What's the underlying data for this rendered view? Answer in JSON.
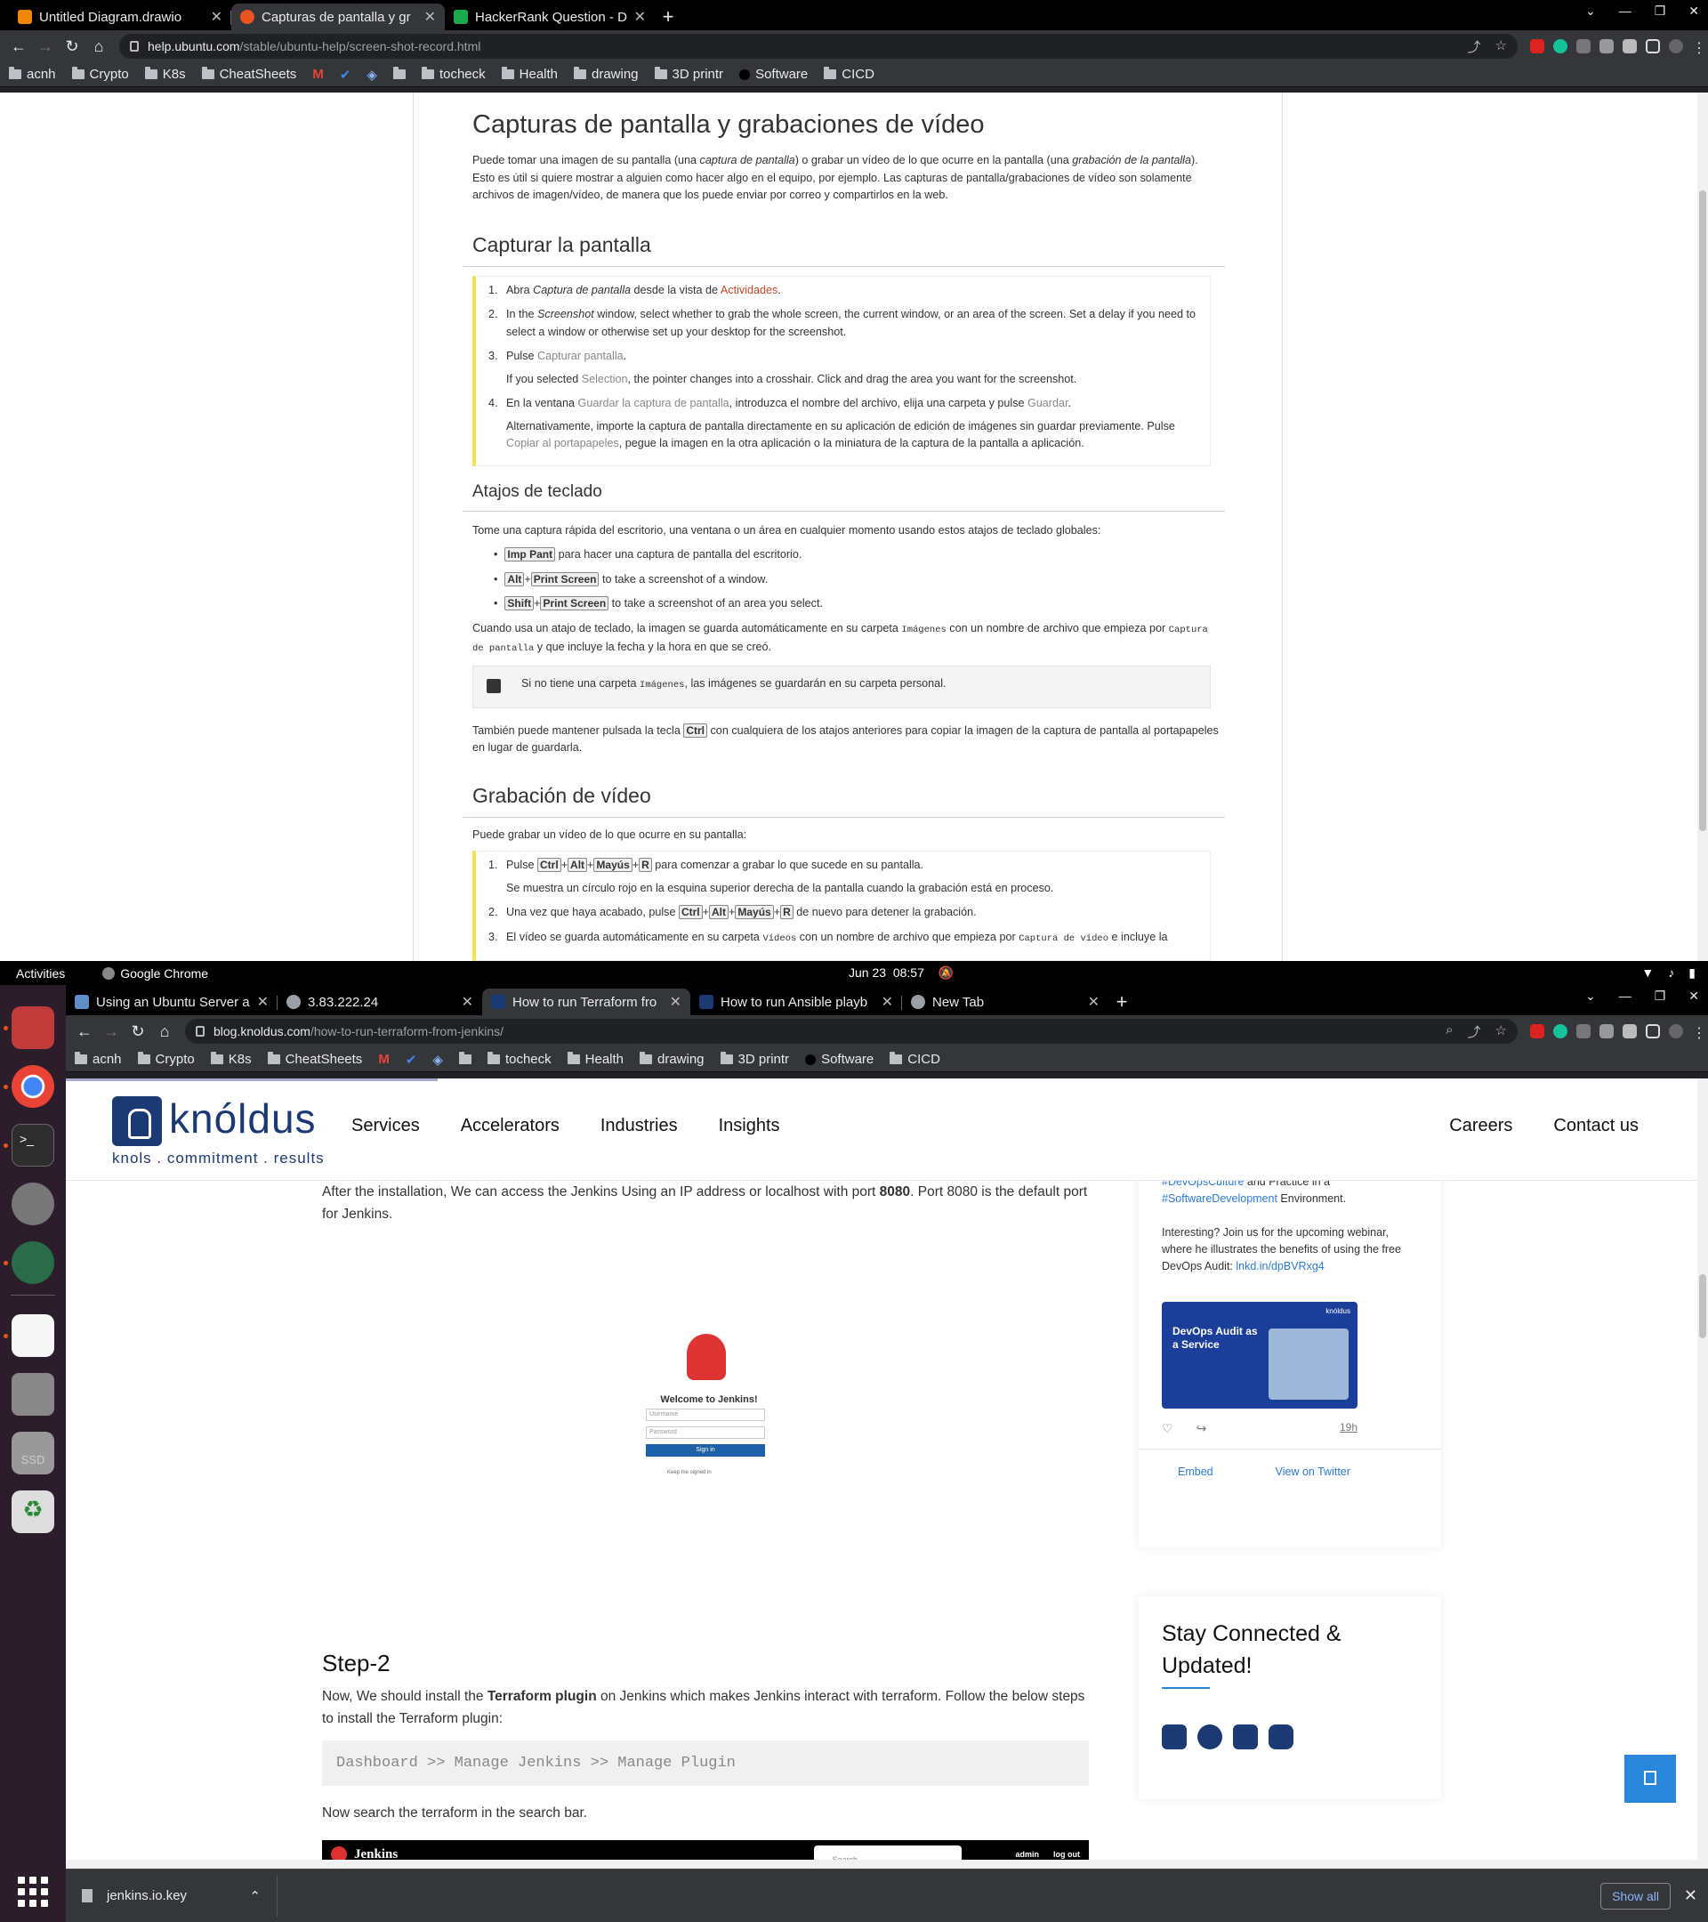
{
  "top_browser": {
    "tabs": [
      {
        "title": "Untitled Diagram.drawio",
        "fav_color": "#f08705",
        "active": false
      },
      {
        "title": "Capturas de pantalla y gr",
        "fav_color": "#e95420",
        "active": true
      },
      {
        "title": "HackerRank Question - De",
        "fav_color": "#1ba94c",
        "active": false
      }
    ],
    "url_host": "help.ubuntu.com",
    "url_path": "/stable/ubuntu-help/screen-shot-record.html"
  },
  "bookmarks": [
    "acnh",
    "Crypto",
    "K8s",
    "CheatSheets",
    "tocheck",
    "Health",
    "drawing",
    "3D printr",
    "Software",
    "CICD"
  ],
  "help": {
    "h1": "Capturas de pantalla y grabaciones de vídeo",
    "intro_1": "Puede tomar una imagen de su pantalla (una ",
    "intro_em1": "captura de pantalla",
    "intro_2": ") o grabar un vídeo de lo que ocurre en la pantalla (una ",
    "intro_em2": "grabación de la pantalla",
    "intro_3": "). Esto es útil si quiere mostrar a alguien como hacer algo en el equipo, por ejemplo. Las capturas de pantalla/grabaciones de vídeo son solamente archivos de imagen/vídeo, de manera que los puede enviar por correo y compartirlos en la web.",
    "h2_capture": "Capturar la pantalla",
    "s1_a": "Abra ",
    "s1_em": "Captura de pantalla",
    "s1_b": " desde la vista de ",
    "s1_link": "Actividades",
    "s1_c": ".",
    "s2_a": "In the ",
    "s2_em": "Screenshot",
    "s2_b": " window, select whether to grab the whole screen, the current window, or an area of the screen. Set a delay if you need to select a window or otherwise set up your desktop for the screenshot.",
    "s3_a": "Pulse ",
    "s3_grey": "Capturar pantalla",
    "s3_b": ".",
    "s3_sub_a": "If you selected ",
    "s3_sub_grey": "Selection",
    "s3_sub_b": ", the pointer changes into a crosshair. Click and drag the area you want for the screenshot.",
    "s4_a": "En la ventana ",
    "s4_grey1": "Guardar la captura de pantalla",
    "s4_b": ", introduzca el nombre del archivo, elija una carpeta y pulse ",
    "s4_grey2": "Guardar",
    "s4_c": ".",
    "s4_sub_a": "Alternativamente, importe la captura de pantalla directamente en su aplicación de edición de imágenes sin guardar previamente. Pulse ",
    "s4_sub_grey": "Copiar al portapapeles",
    "s4_sub_b": ", pegue la imagen en la otra aplicación o la miniatura de la captura de la pantalla a aplicación.",
    "h3_shortcuts": "Atajos de teclado",
    "shortcuts_intro": "Tome una captura rápida del escritorio, una ventana o un área en cualquier momento usando estos atajos de teclado globales:",
    "b1_key": "Imp Pant",
    "b1_text": " para hacer una captura de pantalla del escritorio.",
    "b2_k1": "Alt",
    "b2_k2": "Print Screen",
    "b2_text": " to take a screenshot of a window.",
    "b3_k1": "Shift",
    "b3_k2": "Print Screen",
    "b3_text": " to take a screenshot of an area you select.",
    "auto_a": "Cuando usa un atajo de teclado, la imagen se guarda automáticamente en su carpeta ",
    "auto_m1": "Imágenes",
    "auto_b": " con un nombre de archivo que empieza por ",
    "auto_m2": "Captura de pantalla",
    "auto_c": " y que incluye la fecha y la hora en que se creó.",
    "note_a": "Si no tiene una carpeta ",
    "note_m": "Imágenes",
    "note_b": ", las imágenes se guardarán en su carpeta personal.",
    "ctrl_a": "También puede mantener pulsada la tecla ",
    "ctrl_k": "Ctrl",
    "ctrl_b": " con cualquiera de los atajos anteriores para copiar la imagen de la captura de pantalla al portapapeles en lugar de guardarla.",
    "h2_video": "Grabación de vídeo",
    "video_intro": "Puede grabar un vídeo de lo que ocurre en su pantalla:",
    "v1_a": "Pulse ",
    "v1_keys": [
      "Ctrl",
      "Alt",
      "Mayús",
      "R"
    ],
    "v1_b": " para comenzar a grabar lo que sucede en su pantalla.",
    "v1_sub": "Se muestra un círculo rojo en la esquina superior derecha de la pantalla cuando la grabación está en proceso.",
    "v2_a": "Una vez que haya acabado, pulse ",
    "v2_b": " de nuevo para detener la grabación.",
    "v3_a": "El vídeo se guarda automáticamente en su carpeta ",
    "v3_m1": "Vídeos",
    "v3_b": " con un nombre de archivo que empieza por ",
    "v3_m2": "Captura de vídeo",
    "v3_c": " e incluye la"
  },
  "gnome": {
    "activities": "Activities",
    "app": "Google Chrome",
    "date": "Jun 23",
    "time": "08:57"
  },
  "bottom_browser": {
    "tabs": [
      {
        "title": "Using an Ubuntu Server a",
        "fav_color": "#5f8fc7",
        "active": false
      },
      {
        "title": "3.83.222.24",
        "fav_color": "#9aa0a6",
        "active": false
      },
      {
        "title": "How to run Terraform fro",
        "fav_color": "#1b3a73",
        "active": true
      },
      {
        "title": "How to run Ansible playb",
        "fav_color": "#1b3a73",
        "active": false
      },
      {
        "title": "New Tab",
        "fav_color": "#9aa0a6",
        "active": false
      }
    ],
    "url_host": "blog.knoldus.com",
    "url_path": "/how-to-run-terraform-from-jenkins/"
  },
  "knoldus": {
    "brand": "knóldus",
    "tagline": "knols . commitment . results",
    "nav": [
      "Services",
      "Accelerators",
      "Industries",
      "Insights"
    ],
    "nav_right": [
      "Careers",
      "Contact us"
    ],
    "para1_a": "After the installation, We can access the Jenkins Using an IP address or localhost with port ",
    "para1_b": "8080",
    "para1_c": ". Port 8080 is the default port for Jenkins.",
    "jenkins_welcome": "Welcome to Jenkins!",
    "jenkins_username": "Username",
    "jenkins_password": "Password",
    "jenkins_signin": "Sign in",
    "jenkins_keep": "Keep me signed in",
    "step2": "Step-2",
    "para2_a": "Now, We should install the ",
    "para2_b": "Terraform plugin",
    "para2_c": " on Jenkins which makes Jenkins interact with terraform. Follow the below steps to install the Terraform plugin:",
    "code": "Dashboard >> Manage Jenkins >> Manage Plugin",
    "para3": "Now search the terraform in the search bar.",
    "jenkins_bar_title": "Jenkins",
    "jenkins_search": "Search",
    "jenkins_admin": "admin",
    "jenkins_logout": "log out",
    "tweet_tag1": "#DevOpsCulture",
    "tweet_line1": " and Practice in a",
    "tweet_tag2": "#SoftwareDevelopment",
    "tweet_line2": " Environment.",
    "tweet_body": "Interesting? Join us for the upcoming webinar, where he illustrates the benefits of using the free DevOps Audit: ",
    "tweet_link": "lnkd.in/dpBVRxg4",
    "tweet_img_title": "DevOps Audit as a Service",
    "tweet_img_brand": "knóldus",
    "tweet_time": "19h",
    "embed": "Embed",
    "view_twitter": "View on Twitter",
    "stay": "Stay Connected & Updated!"
  },
  "download": {
    "file": "jenkins.io.key",
    "show_all": "Show all"
  }
}
